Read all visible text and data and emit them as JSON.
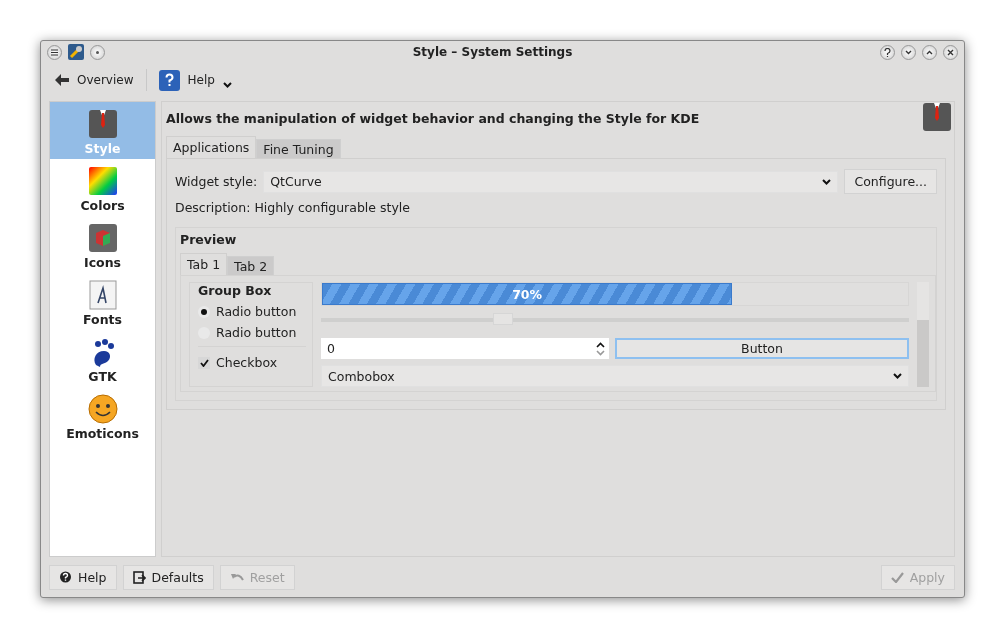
{
  "window": {
    "title": "Style – System Settings"
  },
  "toolbar": [
    {
      "kind": "back",
      "label": "Overview"
    },
    {
      "kind": "help",
      "label": "Help"
    }
  ],
  "sidebar": {
    "items": [
      {
        "label": "Style",
        "selected": true
      },
      {
        "label": "Colors",
        "selected": false
      },
      {
        "label": "Icons",
        "selected": false
      },
      {
        "label": "Fonts",
        "selected": false
      },
      {
        "label": "GTK",
        "selected": false
      },
      {
        "label": "Emoticons",
        "selected": false
      }
    ]
  },
  "header": "Allows the manipulation of widget behavior and changing the Style for KDE",
  "tabs": [
    {
      "label": "Applications",
      "selected": true
    },
    {
      "label": "Fine Tuning",
      "selected": false
    }
  ],
  "widget_style": {
    "label": "Widget style:",
    "value": "QtCurve",
    "configure": "Configure..."
  },
  "description": "Description: Highly configurable style",
  "preview": {
    "title": "Preview",
    "tabs": [
      {
        "label": "Tab 1",
        "selected": true
      },
      {
        "label": "Tab 2",
        "selected": false
      }
    ],
    "group_box": {
      "title": "Group Box",
      "radios": [
        {
          "label": "Radio button",
          "selected": true
        },
        {
          "label": "Radio button",
          "selected": false
        }
      ],
      "checkbox": {
        "label": "Checkbox",
        "checked": true
      }
    },
    "progress": {
      "level": 0.7,
      "reading": "70%"
    },
    "slider": {
      "level": 0.31
    },
    "spinbox": {
      "value": "0"
    },
    "button": "Button",
    "combobox": "Combobox"
  },
  "buttons": [
    {
      "kind": "help",
      "label": "Help",
      "disabled": false
    },
    {
      "kind": "defaults",
      "label": "Defaults",
      "disabled": false
    },
    {
      "kind": "reset",
      "label": "Reset",
      "disabled": true
    }
  ],
  "apply": {
    "label": "Apply",
    "disabled": true
  }
}
